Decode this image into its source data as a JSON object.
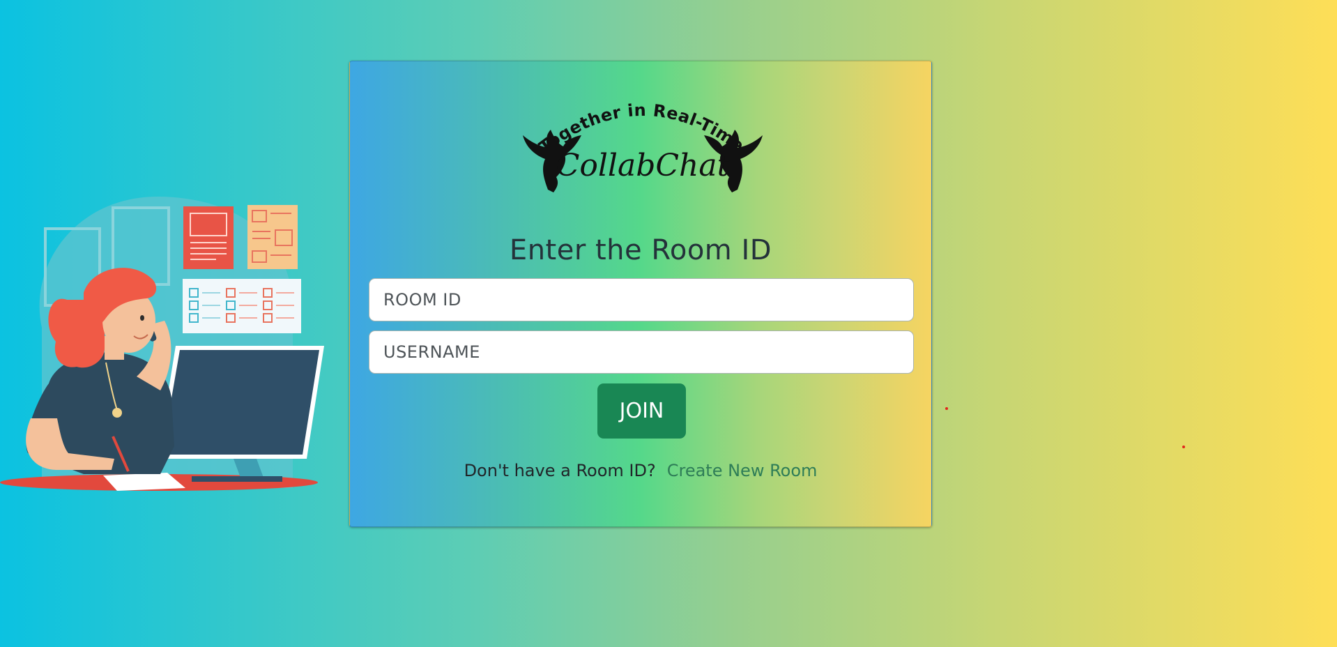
{
  "logo": {
    "tagline": "--Together in Real-Time--",
    "brand": "CollabChat"
  },
  "form": {
    "heading": "Enter the Room ID",
    "room_id_placeholder": "ROOM ID",
    "username_placeholder": "USERNAME",
    "join_label": "JOIN"
  },
  "footer": {
    "prompt": "Don't have a Room ID?",
    "create_link": "Create New Room"
  },
  "colors": {
    "join_button": "#198754",
    "link": "#2e7d57",
    "hair": "#f05a46",
    "desk": "#e2493d",
    "monitor": "#2f4f68"
  },
  "icons": {
    "logo_left": "eagle-icon",
    "logo_right": "eagle-icon"
  }
}
